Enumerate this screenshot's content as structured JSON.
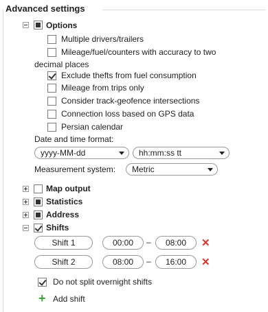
{
  "fieldset": {
    "title": "Advanced settings"
  },
  "options": {
    "label": "Options",
    "items": [
      {
        "label": "Multiple drivers/trailers",
        "checked": false
      },
      {
        "label": "Mileage/fuel/counters with accuracy to two",
        "label_cont": "decimal places",
        "checked": false
      },
      {
        "label": "Exclude thefts from fuel consumption",
        "checked": true
      },
      {
        "label": "Mileage from trips only",
        "checked": false
      },
      {
        "label": "Consider track-geofence intersections",
        "checked": false
      },
      {
        "label": "Connection loss based on GPS data",
        "checked": false
      },
      {
        "label": "Persian calendar",
        "checked": false
      }
    ],
    "datetime_label": "Date and time format:",
    "date_format": "yyyy-MM-dd",
    "time_format": "hh:mm:ss tt",
    "measurement_label": "Measurement system:",
    "measurement": "Metric"
  },
  "sections": [
    {
      "label": "Map output"
    },
    {
      "label": "Statistics"
    },
    {
      "label": "Address"
    }
  ],
  "shifts": {
    "label": "Shifts",
    "items": [
      {
        "name": "Shift 1",
        "from": "00:00",
        "to": "08:00"
      },
      {
        "name": "Shift 2",
        "from": "08:00",
        "to": "16:00"
      }
    ],
    "dash": "–",
    "delete_glyph": "✕",
    "no_split_label": "Do not split overnight shifts",
    "add_label": "Add shift",
    "add_glyph": "+"
  },
  "colors": {
    "delete": "#e0312a",
    "add": "#3aa535"
  }
}
